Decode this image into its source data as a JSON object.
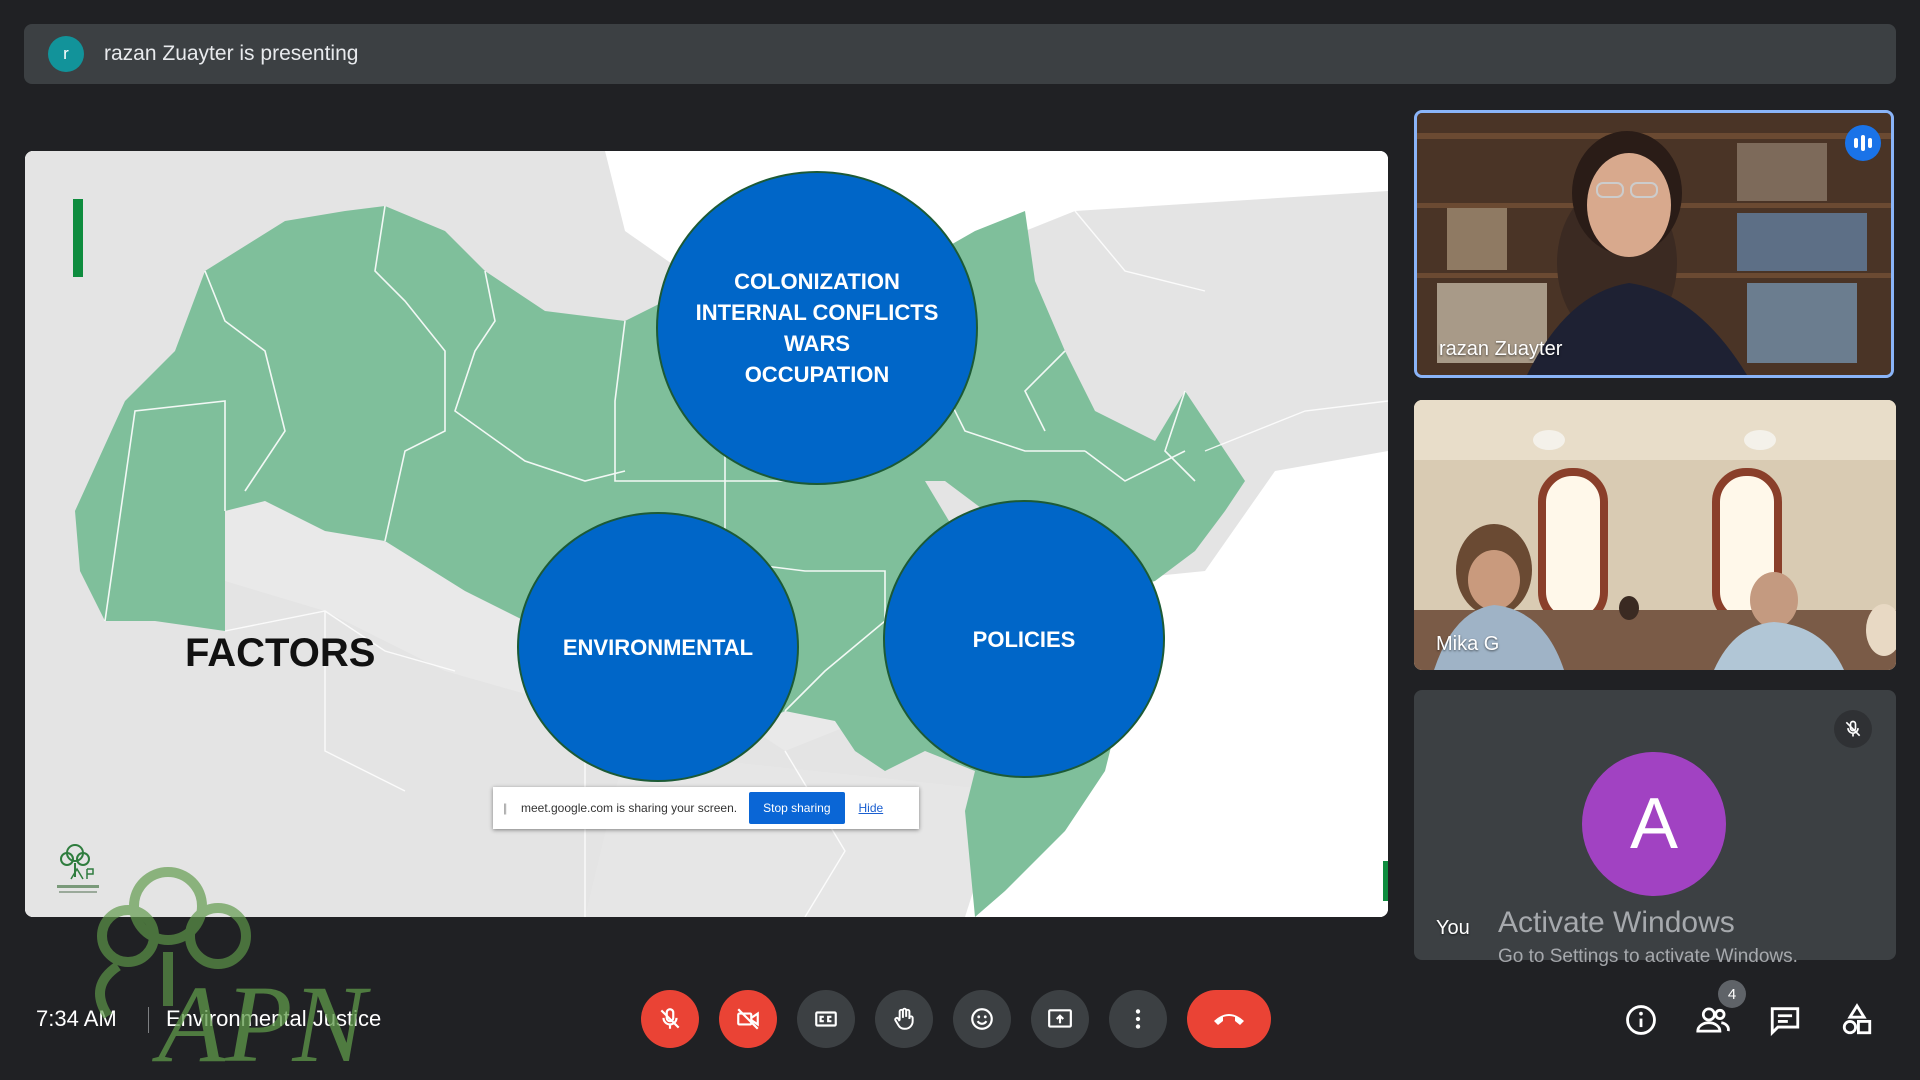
{
  "presenter": {
    "avatar_letter": "r",
    "status": "razan Zuayter is presenting"
  },
  "slide": {
    "circles": {
      "top": [
        "COLONIZATION",
        "INTERNAL CONFLICTS",
        "WARS",
        "OCCUPATION"
      ],
      "left": "ENVIRONMENTAL",
      "right": "POLICIES"
    },
    "factors_label": "FACTORS",
    "share_notice": {
      "text": "meet.google.com is sharing your screen.",
      "stop_label": "Stop sharing",
      "hide_label": "Hide"
    },
    "colors": {
      "map_region": "#7fbf9b",
      "circle_fill": "#0066c8",
      "accent_green": "#0e8c3e"
    }
  },
  "participants": {
    "razan": {
      "name": "razan Zuayter",
      "speaking": true
    },
    "mika": {
      "name": "Mika G"
    },
    "you": {
      "name": "You",
      "avatar_letter": "A",
      "muted": true
    }
  },
  "activation": {
    "title": "Activate Windows",
    "subtitle": "Go to Settings to activate Windows."
  },
  "bottom_bar": {
    "time": "7:34 AM",
    "meeting_title": "Environmental Justice",
    "people_count": "4",
    "controls": [
      "mic-off",
      "camera-off",
      "captions",
      "raise-hand",
      "reactions",
      "present",
      "more-options",
      "leave-call"
    ],
    "side_controls": [
      "meeting-details",
      "people",
      "chat",
      "activities"
    ]
  },
  "watermark": {
    "text": "APN"
  }
}
